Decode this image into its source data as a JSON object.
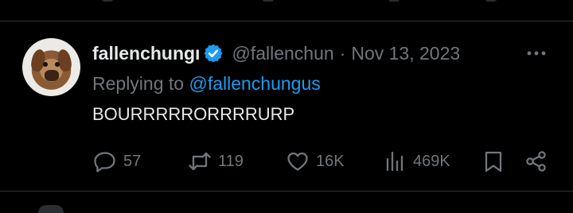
{
  "tweet": {
    "author_name": "fallenchungı",
    "author_handle": "@fallenchun",
    "separator": "·",
    "date": "Nov 13, 2023",
    "replying_prefix": "Replying to ",
    "replying_to": "@fallenchungus",
    "text": "BOURRRRRORRRRURP"
  },
  "actions": {
    "replies": "57",
    "retweets": "119",
    "likes": "16K",
    "views": "469K"
  },
  "icons": {
    "verified": "verified-badge-icon",
    "more": "more-dots-icon",
    "reply": "reply-icon",
    "retweet": "retweet-icon",
    "like": "heart-icon",
    "views": "views-bar-icon",
    "bookmark": "bookmark-icon",
    "share": "share-icon"
  },
  "colors": {
    "background": "#000000",
    "primary_text": "#e7e9ea",
    "secondary_text": "#71767b",
    "accent": "#1d9bf0",
    "divider": "#2f3336"
  }
}
